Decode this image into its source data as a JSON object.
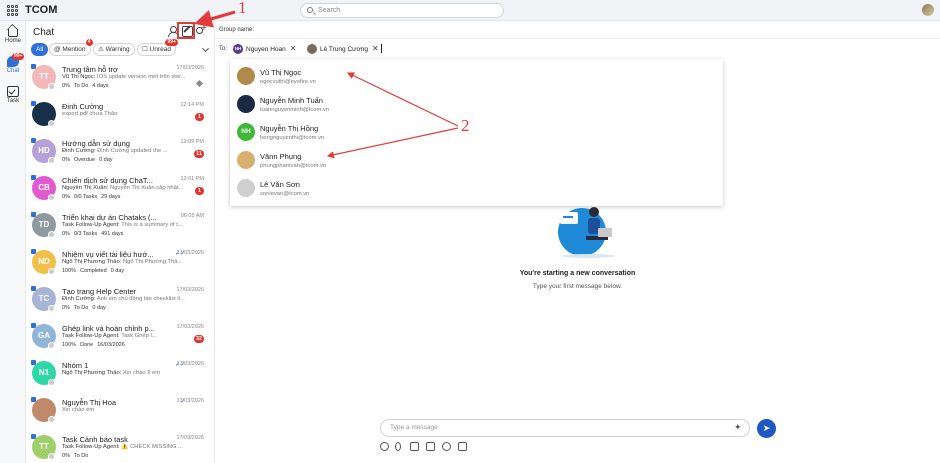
{
  "app": {
    "title": "TCOM",
    "search_placeholder": "Search"
  },
  "rail": {
    "items": [
      {
        "label": "Home",
        "icon": "home-icon"
      },
      {
        "label": "Chat",
        "icon": "chat-icon",
        "badge": "99+"
      },
      {
        "label": "Task",
        "icon": "task-icon"
      }
    ]
  },
  "panel": {
    "title": "Chat",
    "filters": [
      {
        "label": "All",
        "active": true
      },
      {
        "label": "Mention",
        "badge": "4"
      },
      {
        "label": "Warning"
      },
      {
        "label": "Unread",
        "badge": "99+"
      }
    ],
    "conversations": [
      {
        "initials": "TT",
        "color": "#f2b8b8",
        "name": "Trung tâm hỗ trợ",
        "time": "17/03/2026",
        "sender": "Vũ Thị Ngọc:",
        "preview": "IOS update version mới trên stor...",
        "meta": [
          "0%",
          "To Do",
          "4 days"
        ],
        "pinned": true
      },
      {
        "initials": "",
        "color": "#17304a",
        "name": "Đinh Cường",
        "time": "12:14 PM",
        "sender": "",
        "preview": "export pdf chưa Thảo",
        "meta": [],
        "count": "1"
      },
      {
        "initials": "HD",
        "color": "#b6a0d8",
        "name": "Hướng dẫn sử dụng",
        "time": "12:09 PM",
        "sender": "Đinh Cường:",
        "preview": "Đinh Cường updated the ...",
        "meta": [
          "0%",
          "Overdue",
          "0 day"
        ],
        "count": "11"
      },
      {
        "initials": "CB",
        "color": "#e05ad0",
        "name": "Chiến dịch sử dụng ChaT...",
        "time": "12:01 PM",
        "sender": "Nguyễn Thị Xuân:",
        "preview": "Nguyễn Thị Xuân cập nhật...",
        "meta": [
          "0%",
          "0/0 Tasks",
          "29 days"
        ],
        "count": "1"
      },
      {
        "initials": "TD",
        "color": "#8d9aa0",
        "name": "Triển khai dự án Chataks (...",
        "time": "06:05 AM",
        "sender": "Task Follow-Up Agent:",
        "preview": "This is a summary of t...",
        "meta": [
          "0%",
          "0/3 Tasks",
          "491 days"
        ]
      },
      {
        "initials": "ND",
        "color": "#f0c04a",
        "name": "Nhiệm vụ viết tài liệu hướ...",
        "time": "17/03/2026",
        "sender": "Ngô Thị Phương Thảo:",
        "preview": "Ngô Thị Phương Thả...",
        "meta": [
          "100%",
          "Completed",
          "0 day"
        ],
        "tick": "✓✓"
      },
      {
        "initials": "TC",
        "color": "#a7b4d6",
        "name": "Tạo trang Help Center",
        "time": "17/03/2026",
        "sender": "Đinh Cường:",
        "preview": "Anh em chủ động tạo checklist li...",
        "meta": [
          "0%",
          "To Do",
          "0 day"
        ]
      },
      {
        "initials": "GA",
        "color": "#8fb6d8",
        "name": "Ghép link và hoàn chỉnh p...",
        "time": "17/03/2026",
        "sender": "Task Follow-Up Agent:",
        "preview": "Task Ghép l...",
        "meta": [
          "100%",
          "Done",
          "16/03/2026"
        ],
        "count": "32"
      },
      {
        "initials": "N1",
        "color": "#2fd6a8",
        "name": "Nhóm 1",
        "time": "17/03/2026",
        "sender": "Ngô Thị Phương Thảo:",
        "preview": "Xin chào 2 em",
        "meta": [],
        "tick": "✓✓"
      },
      {
        "initials": "",
        "color": "#c08a6a",
        "name": "Nguyễn Thị Hoa",
        "time": "17/03/2026",
        "sender": "",
        "preview": "Xin chào em",
        "meta": [],
        "tick": "✓"
      },
      {
        "initials": "TT",
        "color": "#9ed06a",
        "name": "Task Cảnh báo task",
        "time": "17/03/2026",
        "sender": "Task Follow-Up Agent:",
        "preview": "⚠️ CHECK MISSING ...",
        "meta": [
          "0%",
          "To Do"
        ]
      }
    ]
  },
  "compose": {
    "group_name_label": "Group name:",
    "to_label": "To:",
    "recipients": [
      {
        "name": "Nguyen Hoan",
        "initials": "NH",
        "color": "#5a3a8a"
      },
      {
        "name": "Lê Trung Cương",
        "initials": "",
        "color": "#7a6a5a"
      }
    ],
    "suggestions": [
      {
        "name": "Vũ Thị Ngọc",
        "email": "ngocvuthi@eyefire.vn",
        "initials": "",
        "color": "#b08a4a"
      },
      {
        "name": "Nguyễn Minh Tuấn",
        "email": "tuannguyenminh@tcom.vn",
        "initials": "",
        "color": "#1a2a44"
      },
      {
        "name": "Nguyễn Thị Hồng",
        "email": "hongnguyenthi@tcom.vn",
        "initials": "NH",
        "color": "#3fb83a"
      },
      {
        "name": "Vănn Phụng",
        "email": "phungphamvan@tcom.vn",
        "initials": "",
        "color": "#d8b070"
      },
      {
        "name": "Lê Văn Sơn",
        "email": "sonlevan@tcom.vn",
        "initials": "",
        "color": "#cfcfcf"
      }
    ],
    "empty_title": "You're starting a new conversation",
    "empty_subtitle": "Type your first message below.",
    "message_placeholder": "Type a message"
  },
  "annotations": {
    "label_1": "1",
    "label_2": "2",
    "color": "#e23b3b"
  }
}
